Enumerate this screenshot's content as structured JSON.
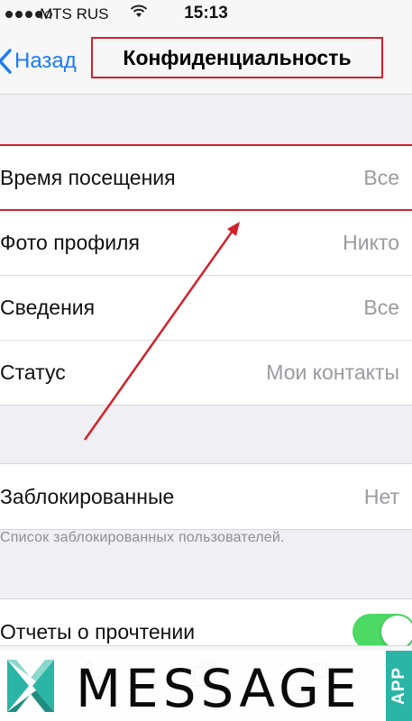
{
  "status_bar": {
    "carrier": "MTS RUS",
    "time": "15:13",
    "icons": [
      "signal-dots",
      "wifi-icon"
    ]
  },
  "nav": {
    "back_label": "Назад",
    "title": "Конфиденциальность"
  },
  "privacy_group": {
    "rows": [
      {
        "label": "Время посещения",
        "value": "Все"
      },
      {
        "label": "Фото профиля",
        "value": "Никто"
      },
      {
        "label": "Сведения",
        "value": "Все"
      },
      {
        "label": "Статус",
        "value": "Мои контакты"
      }
    ]
  },
  "blocked_group": {
    "label": "Заблокированные",
    "value": "Нет",
    "footnote": "Список заблокированных пользователей."
  },
  "receipts_group": {
    "label": "Отчеты о прочтении",
    "toggle_on": true
  },
  "colors": {
    "accent": "#1c7df5",
    "annotation_red": "#d4202a",
    "toggle_green": "#4cd964",
    "watermark_teal": "#2bb5a6"
  },
  "watermark": {
    "text": "MESSAGE",
    "badge": "APP"
  }
}
